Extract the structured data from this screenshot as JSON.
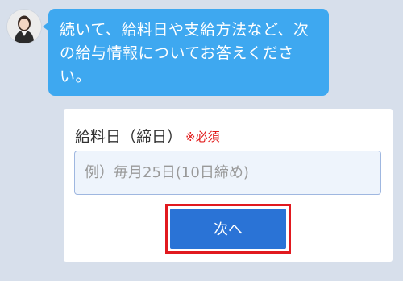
{
  "chat": {
    "message_lines": [
      "続いて、給料日や支給方法など、次",
      "の給与情報についてお答えくださ",
      "い。"
    ]
  },
  "form": {
    "label": "給料日（締日）",
    "required_mark": "※必須",
    "payday_placeholder": "例）毎月25日(10日締め)",
    "payday_value": "",
    "next_label": "次へ"
  },
  "colors": {
    "background": "#d7dfeb",
    "bubble": "#3ea8f0",
    "required": "#e21b1b",
    "button": "#2a73d6",
    "highlight_border": "#e1191f"
  },
  "icons": {
    "avatar": "operator-avatar"
  }
}
